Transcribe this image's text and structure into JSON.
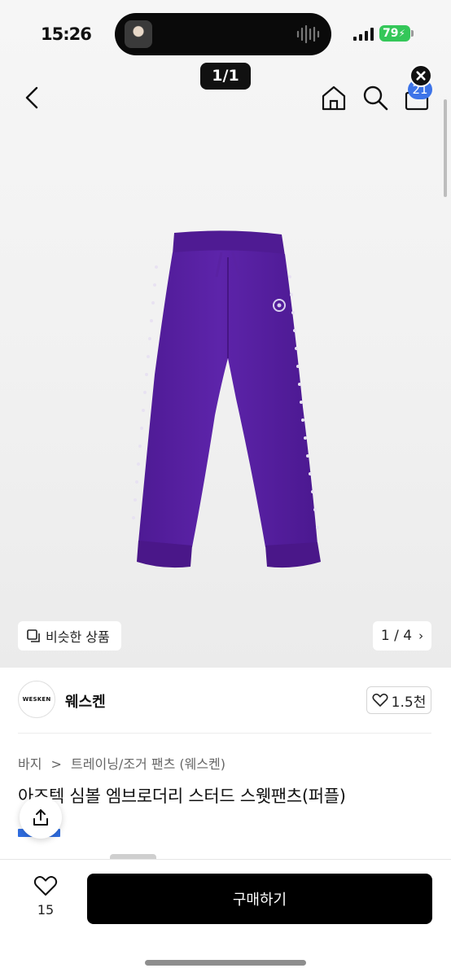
{
  "status_bar": {
    "time": "15:26",
    "battery": "79"
  },
  "viewer": {
    "page_indicator": "1/1"
  },
  "header": {
    "cart_badge": "21",
    "icons": [
      "back-icon",
      "home-icon",
      "search-icon",
      "bag-icon",
      "close-icon"
    ]
  },
  "image": {
    "similar_label": "비슷한 상품",
    "counter": "1 / 4",
    "counter_chevron": "›"
  },
  "brand": {
    "logo_text": "WESKEN",
    "name": "웨스켄",
    "likes": "1.5천"
  },
  "product": {
    "breadcrumb": [
      "바지",
      "트레이닝/조거 팬츠 (웨스켄)"
    ],
    "breadcrumb_sep": ">",
    "title": "아즈텍 심볼 엠브로더리 스터드 스웻팬츠(퍼플)"
  },
  "bottom_bar": {
    "wish_count": "15",
    "buy_label": "구매하기"
  },
  "colors": {
    "product": "#5b22a6",
    "badge": "#3d74e8",
    "battery": "#34c759",
    "buy_button": "#000000"
  }
}
